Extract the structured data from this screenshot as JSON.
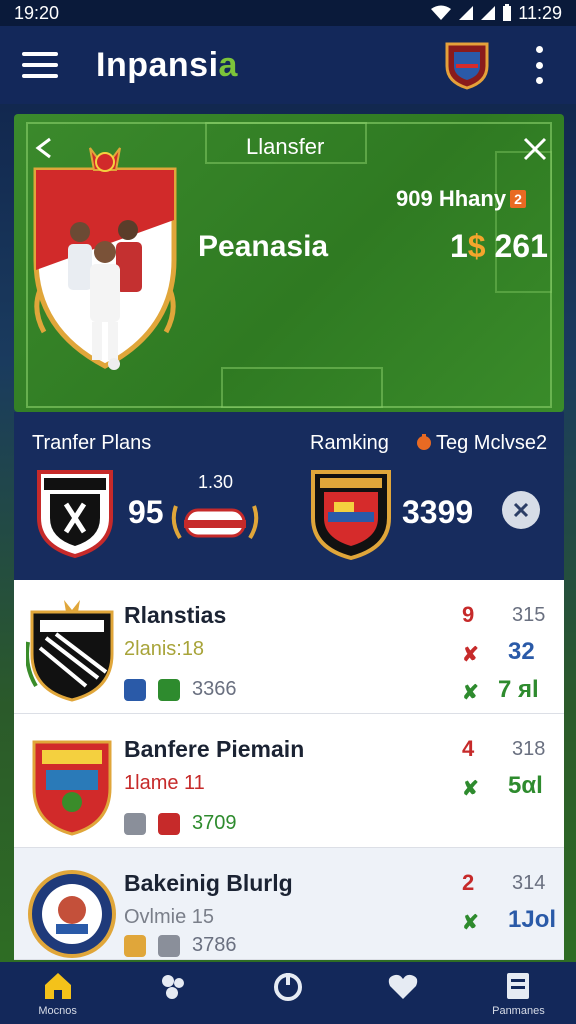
{
  "status_bar": {
    "time_left": "19:20",
    "time_right": "11:29",
    "icons": [
      "wifi-icon",
      "signal-icon",
      "signal-icon",
      "battery-icon"
    ]
  },
  "app_bar": {
    "title_main": "Inpansi",
    "title_accent": "a",
    "icons": [
      "menu-icon",
      "club-logo",
      "more-vert-icon"
    ]
  },
  "hero": {
    "title": "Llansfer",
    "player_name": "Peanasia",
    "meta_text": "909 Hhany",
    "meta_badge": "2",
    "price_prefix": "1",
    "price_currency": "$",
    "price_value": "261",
    "icons": [
      "back-close-icon",
      "close-icon",
      "club-shield"
    ]
  },
  "stats": {
    "transfer_label": "Tranfer Plans",
    "ranking_label": "Ramking",
    "trending_label": "Teg Mclvse2",
    "left_value": "95",
    "small_value": "1.30",
    "right_value": "3399",
    "colors": {
      "trend": "#e86a23"
    }
  },
  "list": {
    "rows": [
      {
        "name": "Rlanstias",
        "sub": "2lanis:18",
        "sub_color": "#a8a43a",
        "meta_value": "3366",
        "meta_color": "#6a7080",
        "rank": "9",
        "rank_color": "#c62a2a",
        "total": "315",
        "x1": "✘",
        "x1_color": "#c62a2a",
        "v1": "32",
        "v1_color": "#2a5aa8",
        "x2": "✘",
        "x2_color": "#2e8b2e",
        "v2": "7 яl",
        "v2_color": "#2e8b2e"
      },
      {
        "name": "Banfere Piemain",
        "sub": "1lame 11",
        "sub_color": "#c62a2a",
        "meta_value": "3709",
        "meta_color": "#2e8b2e",
        "rank": "4",
        "rank_color": "#c62a2a",
        "total": "318",
        "x1": "✘",
        "x1_color": "#2e8b2e",
        "v1": "5αl",
        "v1_color": "#2e8b2e",
        "x2": "",
        "x2_color": "#2e8b2e",
        "v2": "",
        "v2_color": "#2e8b2e"
      },
      {
        "name": "Bakeinig Blurlg",
        "sub": "Ovlmie 15",
        "sub_color": "#7a7f8a",
        "meta_value": "3786",
        "meta_color": "#6a7080",
        "rank": "2",
        "rank_color": "#c62a2a",
        "total": "314",
        "x1": "✘",
        "x1_color": "#2e8b2e",
        "v1": "1Jol",
        "v1_color": "#2a5aa8",
        "x2": "",
        "x2_color": "#2e8b2e",
        "v2": "",
        "v2_color": "#2a5aa8"
      }
    ]
  },
  "bottom_nav": {
    "items": [
      {
        "icon": "home-icon",
        "label": "Mocnos",
        "active": true
      },
      {
        "icon": "group-icon",
        "label": "",
        "active": false
      },
      {
        "icon": "power-icon",
        "label": "",
        "active": false
      },
      {
        "icon": "heart-icon",
        "label": "",
        "active": false
      },
      {
        "icon": "archive-icon",
        "label": "Panmanes",
        "active": false
      }
    ]
  }
}
